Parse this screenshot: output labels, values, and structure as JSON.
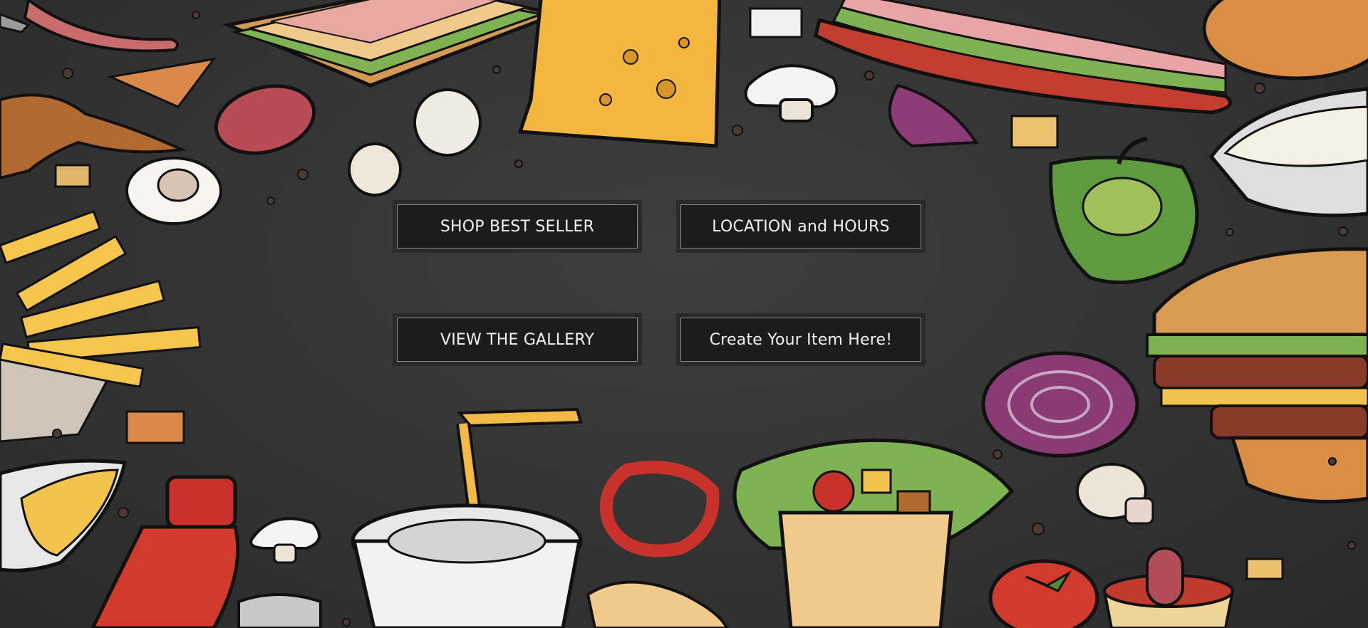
{
  "menu": {
    "shop_best_seller": "SHOP BEST SELLER",
    "location_hours": "LOCATION and HOURS",
    "view_gallery": "VIEW THE GALLERY",
    "create_item": "Create Your Item Here!"
  },
  "colors": {
    "background": "#333333",
    "button_bg": "#1c1c1c",
    "button_border": "#8d8d8d",
    "button_text": "#f2f2f2"
  },
  "icons": [
    "sausage-fork-illustration",
    "sandwich-illustration",
    "cheese-illustration",
    "sub-sandwich-illustration",
    "bread-roll-illustration",
    "chicken-wing-illustration",
    "salami-slice-illustration",
    "mushroom-illustration",
    "onion-slice-illustration",
    "egg-illustration",
    "green-pepper-illustration",
    "dip-bowl-illustration",
    "french-fries-illustration",
    "burger-illustration",
    "red-onion-illustration",
    "drink-cup-illustration",
    "red-pepper-ring-illustration",
    "wrap-illustration",
    "ketchup-bottle-illustration",
    "tomato-illustration",
    "sauce-cup-illustration",
    "croutons-illustration",
    "salt-shaker-illustration"
  ]
}
